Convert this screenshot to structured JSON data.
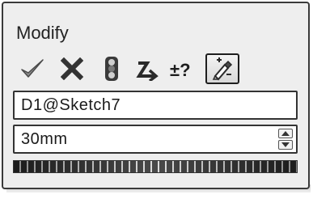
{
  "dialog": {
    "title": "Modify"
  },
  "toolbar": {
    "buttons": [
      {
        "name": "ok",
        "icon": "checkmark-icon"
      },
      {
        "name": "cancel",
        "icon": "close-x-icon"
      },
      {
        "name": "rebuild",
        "icon": "traffic-light-icon"
      },
      {
        "name": "reset-spin-increment",
        "icon": "reverse-arrow-icon"
      },
      {
        "name": "mark-for-drawing",
        "icon": "plus-minus-question-icon"
      },
      {
        "name": "regenerate",
        "icon": "pin-pencil-icon",
        "active": true
      }
    ]
  },
  "dimension": {
    "name": "D1@Sketch7",
    "value": "30mm"
  },
  "colors": {
    "check": "#7a7a7a",
    "cross": "#3a3a3a",
    "frame": "#333333"
  }
}
